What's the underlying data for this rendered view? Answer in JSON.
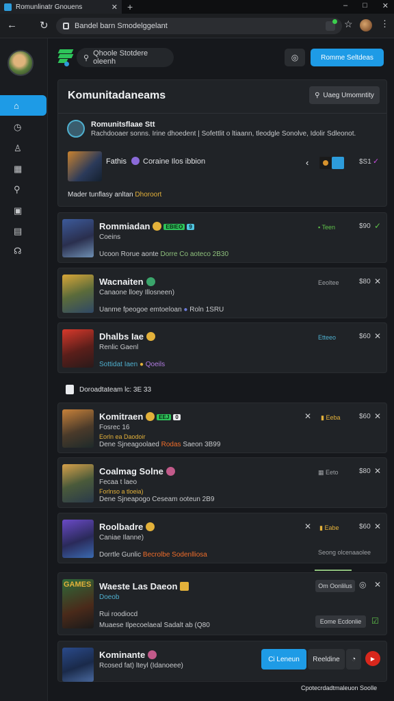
{
  "browser": {
    "tab_title": "Romunlinatr Gnouens",
    "tab_close": "✕",
    "new_tab": "+",
    "window_controls": [
      "–",
      "□",
      "✕"
    ],
    "url": "Bandel barn Smodelggelant",
    "icons": {
      "back": "arrow-left-icon",
      "reload": "reload-icon",
      "star": "star-icon",
      "menu": "kebab-icon"
    }
  },
  "header": {
    "search_placeholder": "Qhoole Stotdere oleenh",
    "primary_button": "Romme Seltdeas",
    "icon_button": "◎"
  },
  "rail": {
    "items": [
      {
        "icon": "home-icon",
        "glyph": "⌂",
        "active": true
      },
      {
        "icon": "clock-icon",
        "glyph": "◷",
        "active": false
      },
      {
        "icon": "user-icon",
        "glyph": "♙",
        "active": false
      },
      {
        "icon": "grid-icon",
        "glyph": "▦",
        "active": false
      },
      {
        "icon": "search-icon",
        "glyph": "⚲",
        "active": false
      },
      {
        "icon": "chat-icon",
        "glyph": "▣",
        "active": false
      },
      {
        "icon": "library-icon",
        "glyph": "▤",
        "active": false
      },
      {
        "icon": "headset-icon",
        "glyph": "☊",
        "active": false
      }
    ]
  },
  "featured": {
    "title": "Komunitadaneams",
    "filter_button": "Uaeg Umomntity",
    "notice_title": "Romunitsflaae Stt",
    "notice_text": "Rachdooaer sonns. Irine dhoedent | Sofettlit o ltiaann, tleodgle Sonolve, Idolir Sdleonot.",
    "item_name": "Fathis",
    "item_mode": "Coraine Ilos ibbion",
    "item_price": "$S1",
    "foot_text": "Mader tunflasy anltan",
    "foot_gold": "Dhoroort"
  },
  "cards": [
    {
      "name": "Rommiadan",
      "badge": "EBIEO",
      "badge2": "9",
      "sub": "Coeins",
      "meta": "Ucoon Rorue aonte",
      "meta_hl": "Dorre Co aoteco 2B30",
      "status": "Teen",
      "price": "$90",
      "action": "✓"
    },
    {
      "name": "Wacnaiten",
      "badge": "",
      "badge2": "",
      "sub": "Canaone lloey Illosneen)",
      "meta": "Uanme fpeogoe emtoeloan",
      "meta_hl": "Roln 1SRU",
      "status": "Eeoltee",
      "price": "$80",
      "action": "✕"
    },
    {
      "name": "Dhalbs Iae",
      "badge": "",
      "badge2": "",
      "sub": "Renlic Gaenl",
      "meta": "Sottidat Iaen",
      "meta_hl": "Qoeils",
      "status": "Etteeo",
      "price": "$60",
      "action": "✕"
    }
  ],
  "section": {
    "label": "Doroadtateam lc: 3E 33"
  },
  "cards2": [
    {
      "name": "Komitraen",
      "badge": "EEJ",
      "badge2": "0",
      "sub": "Fosrec 16",
      "sub2": "Eorln ea Daodoir",
      "meta": "Dene Sjneagoolaed",
      "meta_hl": "Rodas",
      "meta_tail": "Saeon 3B99",
      "status": "Eeba",
      "price": "$60",
      "action": "✕",
      "left_x": "✕"
    },
    {
      "name": "Coalmag Solne",
      "badge": "",
      "badge2": "",
      "sub": "Fecaa t laeo",
      "sub2": "Forlnso a tloeia)",
      "meta": "Dene Sjneapogo Ceseam ooteun 2B9",
      "meta_hl": "",
      "meta_tail": "",
      "status": "Eeto",
      "price": "$80",
      "action": "✕",
      "left_x": ""
    },
    {
      "name": "Roolbadre",
      "badge": "",
      "badge2": "",
      "sub": "Caniae Ilanne)",
      "sub2": "",
      "meta": "Dorrtle Gunlic",
      "meta_hl": "Becrolbe Sodenlliosa",
      "meta_tail": "",
      "status": "Eabe",
      "price": "$60",
      "action": "✕",
      "left_x": "✕",
      "status2": "Seong olcenaaolee"
    },
    {
      "name": "Waeste Las Daeon",
      "badge": "",
      "badge2": "",
      "sub": "Doeob",
      "sub2": "",
      "meta": "Rui roodiocd",
      "meta_hl": "",
      "meta_tail": "",
      "meta2": "Muaese Ilpecoelaeal Sadalt ab (Q80",
      "pill1": "Om Oonlilus",
      "pill2": "Eome Ecdonlie",
      "thumb_label": "GAMES"
    },
    {
      "name": "Kominante",
      "badge": "",
      "badge2": "",
      "sub": "Rcosed fat) lteyl (Idanoeee)",
      "btn_primary": "Ci Leneun",
      "btn_sec": "Reeldine",
      "btn_icon": "◔",
      "play_icon": "▶"
    }
  ],
  "footer": {
    "text": "Cpotecrdadtmaleuon Soolle"
  },
  "colors": {
    "accent": "#1e9be6",
    "green": "#2ec45a",
    "gold": "#e3b13a",
    "orange": "#f06d2a",
    "danger": "#d8271c"
  }
}
